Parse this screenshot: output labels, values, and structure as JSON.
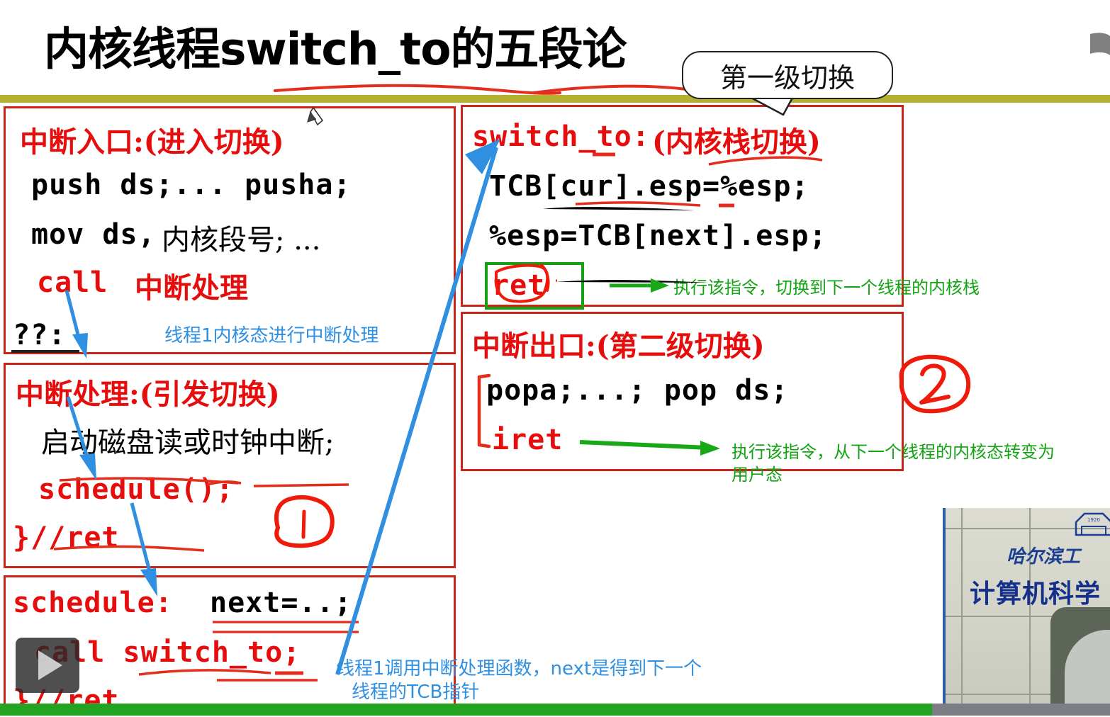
{
  "slide": {
    "title": "内核线程switch_to的五段论",
    "callout": "第一级切换"
  },
  "panels": {
    "interrupt_entry": {
      "header": "中断入口:(进入切换)",
      "line1": "push ds;... pusha;",
      "line2a": "mov ds,",
      "line2b": "内核段号; ...",
      "line3a": "call",
      "line3b": "中断处理",
      "line4": "??:",
      "annotation": "线程1内核态进行中断处理"
    },
    "interrupt_handle": {
      "header": "中断处理:(引发切换)",
      "line1": "启动磁盘读或时钟中断;",
      "line2": "schedule();",
      "line3": "}//ret",
      "marker": "1"
    },
    "schedule": {
      "line1a": "schedule:",
      "line1b": "next=..;",
      "line2": "call switch_to;",
      "line3": "}//ret",
      "annotation_l1": "线程1调用中断处理函数，next是得到下一个",
      "annotation_l2": "线程的TCB指针"
    },
    "switch_to": {
      "header_code": "switch_to:",
      "header_cjk": "(内核栈切换)",
      "line1": "TCB[cur].esp=%esp;",
      "line2": "%esp=TCB[next].esp;",
      "line3": "ret",
      "annotation": "执行该指令，切换到下一个线程的内核栈"
    },
    "interrupt_exit": {
      "header": "中断出口:(第二级切换)",
      "line1": "popa;...; pop ds;",
      "line2": "iret",
      "annotation_l1": "执行该指令，从下一个线程的内核态转变为",
      "annotation_l2": "用户态",
      "marker": "2"
    }
  },
  "video": {
    "caption_top": "哈尔滨工",
    "caption_main": "计算机科学",
    "logo_year": "1920"
  },
  "player": {
    "play_label": "▶",
    "progress_percent": 84
  },
  "colors": {
    "red": "#cc2418",
    "bright_red": "#e60d0d",
    "blue": "#2f8fe0",
    "green": "#13a413",
    "olive": "#b5b130",
    "progress": "#22a422"
  }
}
